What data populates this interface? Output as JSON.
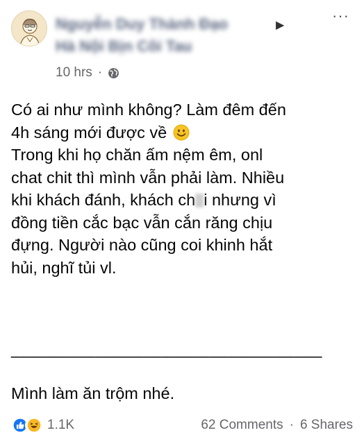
{
  "post": {
    "author_line1": "Nguyễn Duy Thành Đạo",
    "author_line2": "Hà Nội Bịn Côi Tau",
    "time": "10 hrs",
    "separator": "·",
    "icons": {
      "avatar": "cartoon-avatar",
      "audience": "globe-icon",
      "arrow": "triangle-right-icon",
      "menu": "more-options-icon"
    },
    "arrow_glyph": "▶",
    "menu_glyph": "···",
    "text": {
      "line1": "Có ai như mình không? Làm đêm đến",
      "line2": "4h sáng mới được về",
      "line3": "Trong khi họ chăn ấm nệm êm, onl",
      "line4": "chat chit thì mình vẫn phải làm. Nhiều",
      "line5_a": "khi khách đánh, khách ch",
      "line5_b": "i nhưng vì",
      "line6": "đồng tiền cắc bạc vẫn cắn răng chịu",
      "line7": "đựng. Người nào cũng coi khinh hắt",
      "line8": "hủi, nghĩ tủi vl.",
      "divider": "_________________________________",
      "closing": "Mình làm ăn trộm nhé."
    },
    "footer": {
      "reaction_count": "1.1K",
      "comments": "62 Comments",
      "shares": "6 Shares",
      "reaction_icons": [
        "like-icon",
        "haha-icon"
      ]
    },
    "colors": {
      "like_blue": "#1877f2",
      "haha_yellow": "#f7b928",
      "meta_gray": "#65676b"
    }
  }
}
